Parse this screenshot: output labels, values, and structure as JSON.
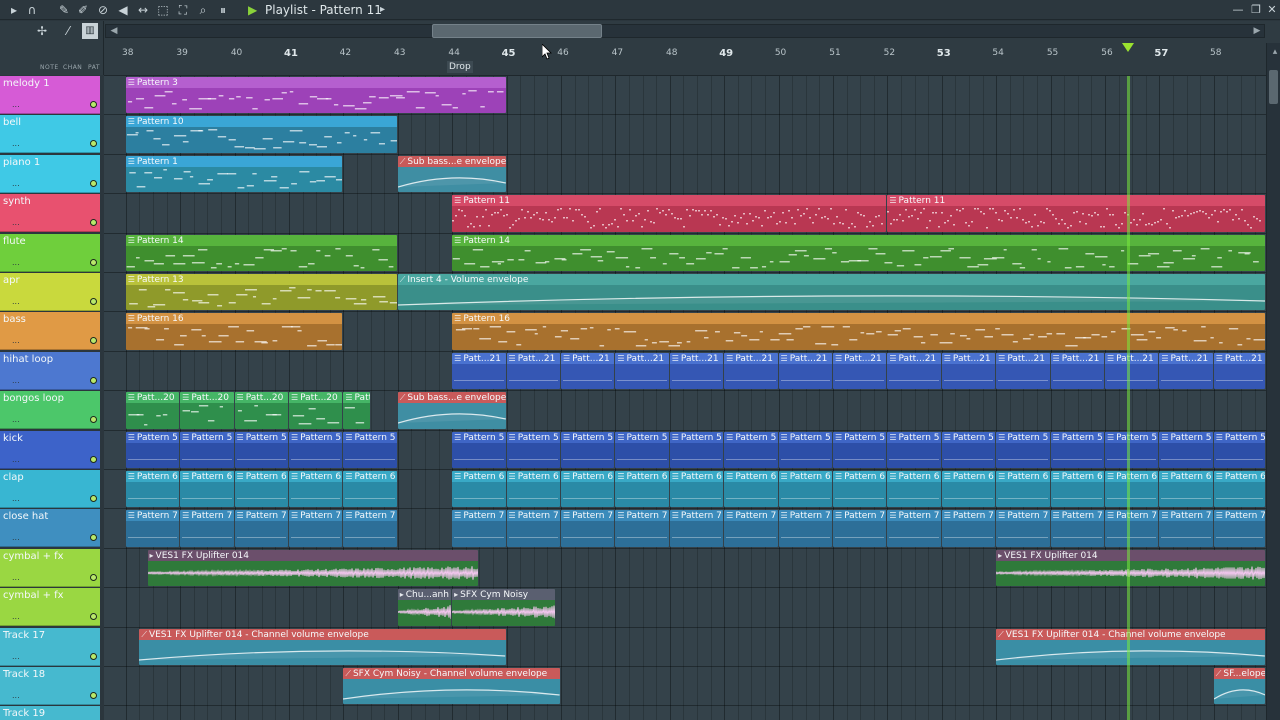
{
  "window": {
    "title": "Playlist - Pattern 11",
    "title_arrow": "▶",
    "more": "▸"
  },
  "toolbar_icons": [
    "play-icon",
    "magnet-icon",
    "pencil-icon",
    "brush-icon",
    "delete-icon",
    "mute-icon",
    "slip-icon",
    "select-icon",
    "zoom-icon",
    "playback-icon"
  ],
  "left_head": {
    "mode_note": "NOTE",
    "mode_chan": "CHAN",
    "mode_pat": "PAT"
  },
  "ruler": {
    "bars": [
      "38",
      "39",
      "40",
      "41",
      "42",
      "43",
      "44",
      "45",
      "46",
      "47",
      "48",
      "49",
      "50",
      "51",
      "52",
      "53",
      "54",
      "55",
      "56",
      "57",
      "58"
    ],
    "major": [
      "41",
      "45",
      "49",
      "53",
      "57"
    ],
    "marker": "Drop"
  },
  "tracks": [
    {
      "name": "melody 1",
      "color": "#d65bd6"
    },
    {
      "name": "bell",
      "color": "#3fc9e6"
    },
    {
      "name": "piano 1",
      "color": "#3fc9e6"
    },
    {
      "name": "synth",
      "color": "#e8516f"
    },
    {
      "name": "flute",
      "color": "#6fcf3c"
    },
    {
      "name": "apr",
      "color": "#c9d93d"
    },
    {
      "name": "bass",
      "color": "#e09a45"
    },
    {
      "name": "hihat loop",
      "color": "#4d78d0"
    },
    {
      "name": "bongos loop",
      "color": "#4cc76a"
    },
    {
      "name": "kick",
      "color": "#3d63c9"
    },
    {
      "name": "clap",
      "color": "#38b6d2"
    },
    {
      "name": "close hat",
      "color": "#3f8fc0"
    },
    {
      "name": "cymbal + fx",
      "color": "#9ad742"
    },
    {
      "name": "cymbal + fx",
      "color": "#9ad742"
    },
    {
      "name": "Track 17",
      "color": "#46b9cf"
    },
    {
      "name": "Track 18",
      "color": "#46b9cf"
    },
    {
      "name": "Track 19",
      "color": "#46b9cf"
    }
  ],
  "clips": [
    {
      "track": 0,
      "from": 38.0,
      "to": 45.0,
      "label": "Pattern 3",
      "color": "#9d42b8",
      "head": "#b55fcf",
      "kind": "notes"
    },
    {
      "track": 1,
      "from": 38.0,
      "to": 43.0,
      "label": "Pattern 10",
      "color": "#2c7fa0",
      "head": "#3aa6d6",
      "kind": "notes"
    },
    {
      "track": 2,
      "from": 38.0,
      "to": 42.0,
      "label": "Pattern 1",
      "color": "#2b8aa3",
      "head": "#3aa6d6",
      "kind": "notes"
    },
    {
      "track": 2,
      "from": 43.0,
      "to": 45.0,
      "label": "Sub bass...e envelope",
      "color": "#3f8ea3",
      "head": "#c95a5a",
      "kind": "env"
    },
    {
      "track": 3,
      "from": 44.0,
      "to": 52.0,
      "label": "Pattern 11",
      "color": "#b93752",
      "head": "#d64b68",
      "kind": "dense"
    },
    {
      "track": 3,
      "from": 52.0,
      "to": 59.0,
      "label": "Pattern 11",
      "color": "#b93752",
      "head": "#d64b68",
      "kind": "dense"
    },
    {
      "track": 4,
      "from": 38.0,
      "to": 43.0,
      "label": "Pattern 14",
      "color": "#3f8f2e",
      "head": "#57b43d",
      "kind": "notes"
    },
    {
      "track": 4,
      "from": 44.0,
      "to": 59.0,
      "label": "Pattern 14",
      "color": "#3f8f2e",
      "head": "#57b43d",
      "kind": "notes"
    },
    {
      "track": 5,
      "from": 38.0,
      "to": 43.0,
      "label": "Pattern 13",
      "color": "#8f9a2a",
      "head": "#b9c23a",
      "kind": "notes"
    },
    {
      "track": 5,
      "from": 43.0,
      "to": 59.0,
      "label": "Insert 4 - Volume envelope",
      "color": "#3a8f8a",
      "head": "#4aa7a0",
      "kind": "env"
    },
    {
      "track": 6,
      "from": 38.0,
      "to": 42.0,
      "label": "Pattern 16",
      "color": "#a8712e",
      "head": "#d39243",
      "kind": "notes"
    },
    {
      "track": 6,
      "from": 44.0,
      "to": 59.0,
      "label": "Pattern 16",
      "color": "#a8712e",
      "head": "#d39243",
      "kind": "notes"
    },
    {
      "track": 8,
      "from": 38.0,
      "to": 42.5,
      "label": "Patt...20",
      "color": "#2f8f4c",
      "head": "#45b566",
      "kind": "loop4"
    },
    {
      "track": 8,
      "from": 43.0,
      "to": 45.0,
      "label": "Sub bass...e envelope",
      "color": "#3f8ea3",
      "head": "#c95a5a",
      "kind": "env"
    },
    {
      "track": 14,
      "from": 38.25,
      "to": 45.0,
      "label": "VES1 FX Uplifter 014 - Channel volume envelope",
      "color": "#3a8ea5",
      "head": "#c95a5a",
      "kind": "env"
    },
    {
      "track": 14,
      "from": 54.0,
      "to": 59.0,
      "label": "VES1 FX Uplifter 014 - Channel volume envelope",
      "color": "#3a8ea5",
      "head": "#c95a5a",
      "kind": "env"
    },
    {
      "track": 15,
      "from": 42.0,
      "to": 46.0,
      "label": "SFX Cym Noisy - Channel volume envelope",
      "color": "#3a8ea5",
      "head": "#c95a5a",
      "kind": "env"
    },
    {
      "track": 15,
      "from": 58.0,
      "to": 59.0,
      "label": "SF...elope",
      "color": "#3a8ea5",
      "head": "#c95a5a",
      "kind": "env"
    }
  ],
  "loops": [
    {
      "track": 7,
      "from": 44.0,
      "to": 59.0,
      "label": "Patt...21",
      "color": "#3557b4",
      "head": "#4a72d0",
      "step": 1.0
    },
    {
      "track": 9,
      "from": 38.0,
      "to": 43.0,
      "label": "Pattern 5",
      "color": "#2d4fa8",
      "head": "#3f66c6",
      "step": 1.0
    },
    {
      "track": 9,
      "from": 44.0,
      "to": 59.0,
      "label": "Pattern 5",
      "color": "#2d4fa8",
      "head": "#3f66c6",
      "step": 1.0
    },
    {
      "track": 10,
      "from": 38.0,
      "to": 43.0,
      "label": "Pattern 6",
      "color": "#2a8aa6",
      "head": "#39a9c6",
      "step": 1.0
    },
    {
      "track": 10,
      "from": 44.0,
      "to": 59.0,
      "label": "Pattern 6",
      "color": "#2a8aa6",
      "head": "#39a9c6",
      "step": 1.0
    },
    {
      "track": 11,
      "from": 38.0,
      "to": 43.0,
      "label": "Pattern 7",
      "color": "#2d6f98",
      "head": "#3b8bbb",
      "step": 1.0
    },
    {
      "track": 11,
      "from": 44.0,
      "to": 59.0,
      "label": "Pattern 7",
      "color": "#2d6f98",
      "head": "#3b8bbb",
      "step": 1.0
    }
  ],
  "audio": [
    {
      "track": 12,
      "from": 38.4,
      "to": 44.5,
      "label": "VES1 FX Uplifter 014",
      "color": "#2f7a3a",
      "head": "#6b4f6b"
    },
    {
      "track": 12,
      "from": 54.0,
      "to": 59.0,
      "label": "VES1 FX Uplifter 014",
      "color": "#2f7a3a",
      "head": "#6b4f6b"
    },
    {
      "track": 13,
      "from": 43.0,
      "to": 44.0,
      "label": "Chu...anh",
      "color": "#2f7a3a",
      "head": "#5a5f70"
    },
    {
      "track": 13,
      "from": 44.0,
      "to": 45.9,
      "label": "SFX Cym Noisy",
      "color": "#2f7a3a",
      "head": "#5a5f70"
    }
  ],
  "playhead_bar": 56.4,
  "accent": "#9be22f"
}
